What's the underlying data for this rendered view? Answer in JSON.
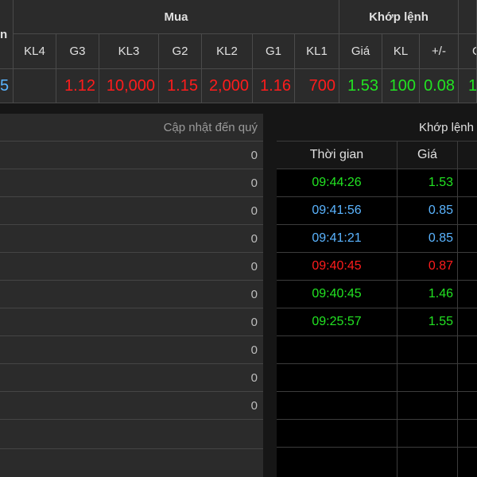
{
  "board": {
    "group_left_fragment": "n",
    "group_buy": "Mua",
    "group_match": "Khớp lệnh",
    "group_right_fragment": "",
    "columns": [
      "KL4",
      "G3",
      "KL3",
      "G2",
      "KL2",
      "G1",
      "KL1",
      "Giá",
      "KL",
      "+/-",
      "G"
    ],
    "row": {
      "left_fragment": "5",
      "kl4": "",
      "g3": "1.12",
      "kl3": "10,000",
      "g2": "1.15",
      "kl2": "2,000",
      "g1": "1.16",
      "kl1": "700",
      "match_price": "1.53",
      "match_volume": "100",
      "match_change": "0.08",
      "right_fragment": "1."
    }
  },
  "left_panel": {
    "header": "Cập nhật đến quý",
    "values": [
      "0",
      "0",
      "0",
      "0",
      "0",
      "0",
      "0",
      "0",
      "0",
      "0"
    ]
  },
  "right_panel": {
    "title": "Khớp lệnh",
    "col_time": "Thời gian",
    "col_price": "Giá",
    "trades": [
      {
        "time": "09:44:26",
        "price": "1.53",
        "color": "#22e322"
      },
      {
        "time": "09:41:56",
        "price": "0.85",
        "color": "#5ab4ff"
      },
      {
        "time": "09:41:21",
        "price": "0.85",
        "color": "#5ab4ff"
      },
      {
        "time": "09:40:45",
        "price": "0.87",
        "color": "#ff1c1c"
      },
      {
        "time": "09:40:45",
        "price": "1.46",
        "color": "#22e322"
      },
      {
        "time": "09:25:57",
        "price": "1.55",
        "color": "#22e322"
      }
    ]
  },
  "colors": {
    "up": "#22e322",
    "down": "#ff1c1c",
    "reference": "#5ab4ff"
  }
}
